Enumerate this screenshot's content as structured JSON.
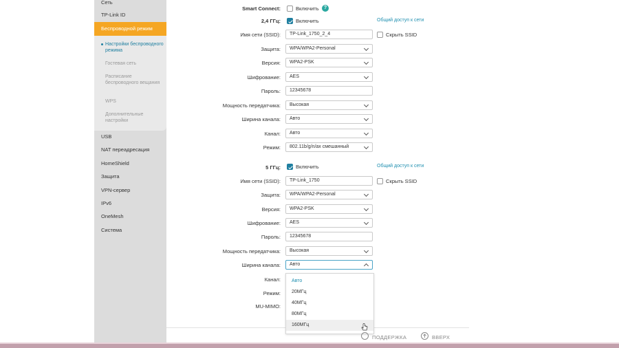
{
  "sidebar": {
    "items": [
      {
        "label": "Сеть"
      },
      {
        "label": "TP-Link ID"
      },
      {
        "label": "Беспроводной режим"
      },
      {
        "label": "USB"
      },
      {
        "label": "NAT переадресация"
      },
      {
        "label": "HomeShield"
      },
      {
        "label": "Защита"
      },
      {
        "label": "VPN-сервер"
      },
      {
        "label": "IPv6"
      },
      {
        "label": "OneMesh"
      },
      {
        "label": "Система"
      }
    ],
    "subitems": [
      {
        "label": "Настройки беспроводного режима"
      },
      {
        "label": "Гостевая сеть"
      },
      {
        "label": "Расписание беспроводного вещания"
      },
      {
        "label": "WPS"
      },
      {
        "label": "Дополнительные настройки"
      }
    ]
  },
  "smart_connect": {
    "label": "Smart Connect:",
    "toggle": "Включить",
    "help": "?"
  },
  "band24": {
    "band_label": "2,4 ГГц:",
    "enable": "Включить",
    "share": "Общий доступ к сети",
    "ssid_label": "Имя сети (SSID):",
    "ssid": "TP-Link_1750_2_4",
    "hide_ssid": "Скрыть SSID",
    "security_label": "Защита:",
    "security": "WPA/WPA2-Personal",
    "version_label": "Версия:",
    "version": "WPA2-PSK",
    "encryption_label": "Шифрование:",
    "encryption": "AES",
    "password_label": "Пароль:",
    "password": "12345678",
    "power_label": "Мощность передатчика:",
    "power": "Высокая",
    "width_label": "Ширина канала:",
    "width": "Авто",
    "channel_label": "Канал:",
    "channel": "Авто",
    "mode_label": "Режим:",
    "mode": "802.11b/g/n/ax смешанный"
  },
  "band5": {
    "band_label": "5 ГГц:",
    "enable": "Включить",
    "share": "Общий доступ к сети",
    "ssid_label": "Имя сети (SSID):",
    "ssid": "TP-Link_1750",
    "hide_ssid": "Скрыть SSID",
    "security_label": "Защита:",
    "security": "WPA/WPA2-Personal",
    "version_label": "Версия:",
    "version": "WPA2-PSK",
    "encryption_label": "Шифрование:",
    "encryption": "AES",
    "password_label": "Пароль:",
    "password": "12345678",
    "power_label": "Мощность передатчика:",
    "power": "Высокая",
    "width_label": "Ширина канала:",
    "width": "Авто",
    "channel_label": "Канал:",
    "mode_label": "Режим:",
    "mumimo_label": "MU-MIMO:"
  },
  "dropdown": {
    "options": [
      {
        "label": "Авто"
      },
      {
        "label": "20МГц"
      },
      {
        "label": "40МГц"
      },
      {
        "label": "80МГц"
      },
      {
        "label": "160МГц"
      }
    ]
  },
  "footer": {
    "support": "ПОДДЕРЖКА",
    "up": "ВВЕРХ"
  },
  "colors": {
    "accent": "#f5a623",
    "link": "#1f8fb0",
    "checkbox": "#1f7fa0"
  }
}
